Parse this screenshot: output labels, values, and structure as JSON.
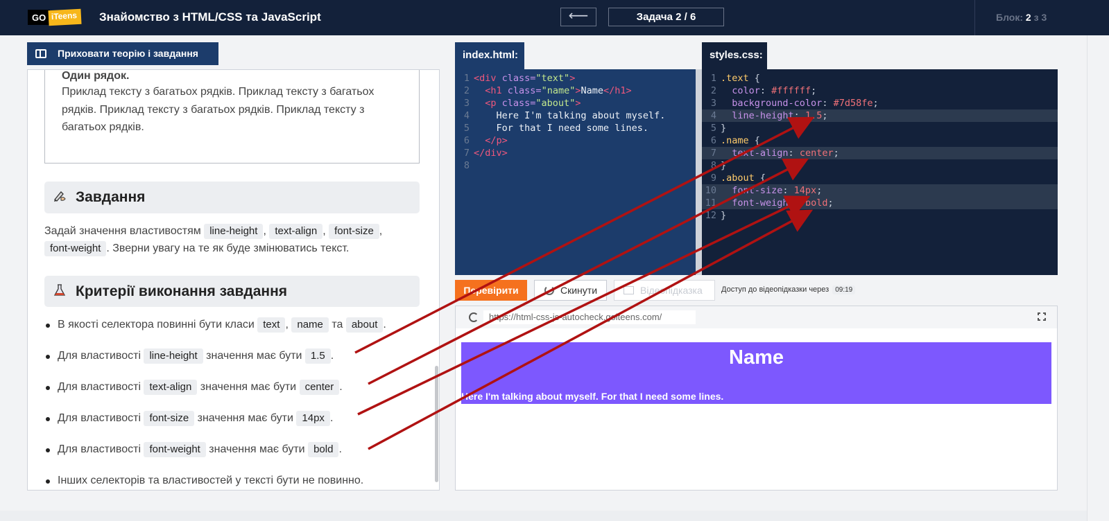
{
  "header": {
    "logo_go": "GO",
    "logo_teens": "iTeens",
    "title": "Знайомство з HTML/CSS та JavaScript",
    "back_arrow": "⟵",
    "task_counter": "Задача 2 / 6",
    "block_label": "Блок:",
    "block_current": "2",
    "block_sep": "з",
    "block_total": "3"
  },
  "left": {
    "hide_button": "Приховати теорію і завдання",
    "example_one_line": "Один рядок.",
    "example_multi_line": "Приклад тексту з багатьох рядків. Приклад тексту з багатьох рядків. Приклад тексту з багатьох рядків. Приклад тексту з багатьох рядків.",
    "task_heading": "Завдання",
    "task_text_1": "Задай значення властивостям",
    "task_chips": [
      "line-height",
      "text-align",
      "font-size",
      "font-weight"
    ],
    "task_text_2": ". Зверни увагу на те як буде змінюватись текст.",
    "criteria_heading": "Критерії виконання завдання",
    "criteria": [
      {
        "pre": "В якості селектора повинні бути класи",
        "chips": [
          "text",
          "name",
          "about"
        ],
        "joiners": [
          ",",
          "та",
          "."
        ]
      },
      {
        "pre": "Для властивості",
        "prop": "line-height",
        "mid": "значення має бути",
        "val": "1.5",
        "end": "."
      },
      {
        "pre": "Для властивості",
        "prop": "text-align",
        "mid": "значення має бути",
        "val": "center",
        "end": "."
      },
      {
        "pre": "Для властивості",
        "prop": "font-size",
        "mid": "значення має бути",
        "val": "14px",
        "end": "."
      },
      {
        "pre": "Для властивості",
        "prop": "font-weight",
        "mid": "значення має бути",
        "val": "bold",
        "end": "."
      }
    ],
    "criteria_last": "Інших селекторів та властивостей у тексті бути не повинно."
  },
  "editors": {
    "html_tab": "index.html:",
    "css_tab": "styles.css:",
    "html_lines": [
      [
        [
          "tag",
          "<div "
        ],
        [
          "attr",
          "class="
        ],
        [
          "str",
          "\"text\""
        ],
        [
          "tag",
          ">"
        ]
      ],
      [
        [
          "tag",
          "  <h1 "
        ],
        [
          "attr",
          "class="
        ],
        [
          "str",
          "\"name\""
        ],
        [
          "tag",
          ">"
        ],
        [
          "txt",
          "Name"
        ],
        [
          "tag",
          "</h1>"
        ]
      ],
      [
        [
          "tag",
          "  <p "
        ],
        [
          "attr",
          "class="
        ],
        [
          "str",
          "\"about\""
        ],
        [
          "tag",
          ">"
        ]
      ],
      [
        [
          "txt",
          "    Here I'm talking about myself."
        ]
      ],
      [
        [
          "txt",
          "    For that I need some lines."
        ]
      ],
      [
        [
          "tag",
          "  </p>"
        ]
      ],
      [
        [
          "tag",
          "</div>"
        ]
      ],
      [
        [
          "txt",
          ""
        ]
      ]
    ],
    "css_lines": [
      [
        [
          "sel",
          ".text "
        ],
        [
          "pun",
          "{"
        ]
      ],
      [
        [
          "prop",
          "  color"
        ],
        [
          "pun",
          ": "
        ],
        [
          "val",
          "#ffffff"
        ],
        [
          "pun",
          ";"
        ]
      ],
      [
        [
          "prop",
          "  background-color"
        ],
        [
          "pun",
          ": "
        ],
        [
          "val",
          "#7d58fe"
        ],
        [
          "pun",
          ";"
        ]
      ],
      [
        [
          "prop",
          "  line-height"
        ],
        [
          "pun",
          ": "
        ],
        [
          "val",
          "1.5"
        ],
        [
          "pun",
          ";"
        ]
      ],
      [
        [
          "pun",
          "}"
        ]
      ],
      [
        [
          "sel",
          ".name "
        ],
        [
          "pun",
          "{"
        ]
      ],
      [
        [
          "prop",
          "  text-align"
        ],
        [
          "pun",
          ": "
        ],
        [
          "val",
          "center"
        ],
        [
          "pun",
          ";"
        ]
      ],
      [
        [
          "pun",
          "}"
        ]
      ],
      [
        [
          "sel",
          ".about "
        ],
        [
          "pun",
          "{"
        ]
      ],
      [
        [
          "prop",
          "  font-size"
        ],
        [
          "pun",
          ": "
        ],
        [
          "val",
          "14px"
        ],
        [
          "pun",
          ";"
        ]
      ],
      [
        [
          "prop",
          "  font-weight"
        ],
        [
          "pun",
          ": "
        ],
        [
          "val",
          "bold"
        ],
        [
          "pun",
          ";"
        ]
      ],
      [
        [
          "pun",
          "}"
        ]
      ]
    ],
    "css_highlight_lines": [
      4,
      7,
      10,
      11
    ]
  },
  "controls": {
    "check": "Перевірити",
    "reset": "Скинути",
    "video_hint": "Відеопідказка",
    "access_text": "Доступ до відеопідказки через",
    "timer": "09:19"
  },
  "preview": {
    "url": "https://html-css-js-autocheck.goiteens.com/",
    "name": "Name",
    "about": "Here I'm talking about myself. For that I need some lines.",
    "bg_color": "#7d58fe"
  },
  "annotation_color": "#b01212"
}
